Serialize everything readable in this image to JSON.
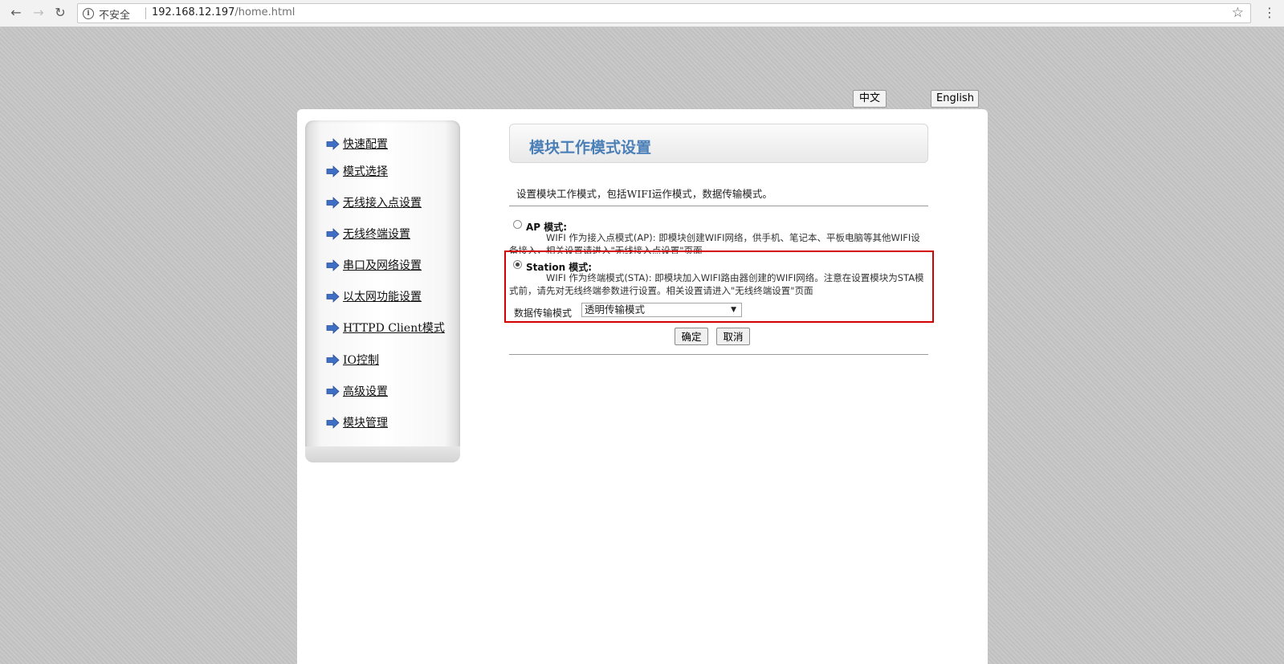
{
  "browser": {
    "security_label": "不安全",
    "url_host": "192.168.12.197",
    "url_path": "/home.html"
  },
  "language": {
    "chinese_label": "中文",
    "english_label": "English"
  },
  "sidebar": {
    "arrow_color": "#3f6fc4",
    "items": [
      {
        "label": "快速配置"
      },
      {
        "label": "模式选择"
      },
      {
        "label": "无线接入点设置"
      },
      {
        "label": "无线终端设置"
      },
      {
        "label": "串口及网络设置"
      },
      {
        "label": "以太网功能设置"
      },
      {
        "label": "HTTPD Client模式"
      },
      {
        "label": "IO控制"
      },
      {
        "label": "高级设置"
      },
      {
        "label": "模块管理"
      }
    ]
  },
  "main": {
    "title": "模块工作模式设置",
    "description": "设置模块工作模式，包括WIFI运作模式，数据传输模式。",
    "ap_mode": {
      "label": "AP 模式:",
      "description": "WIFI 作为接入点模式(AP): 即模块创建WIFI网络，供手机、笔记本、平板电脑等其他WIFI设备接入，相关设置请进入\"无线接入点设置\"页面",
      "checked": false
    },
    "station_mode": {
      "label": "Station 模式:",
      "description": "WIFI 作为终端模式(STA): 即模块加入WIFI路由器创建的WIFI网络。注意在设置模块为STA模式前，请先对无线终端参数进行设置。相关设置请进入\"无线终端设置\"页面",
      "checked": true
    },
    "data_mode_label": "数据传输模式",
    "data_mode_value": "透明传输模式",
    "confirm_label": "确定",
    "cancel_label": "取消"
  }
}
